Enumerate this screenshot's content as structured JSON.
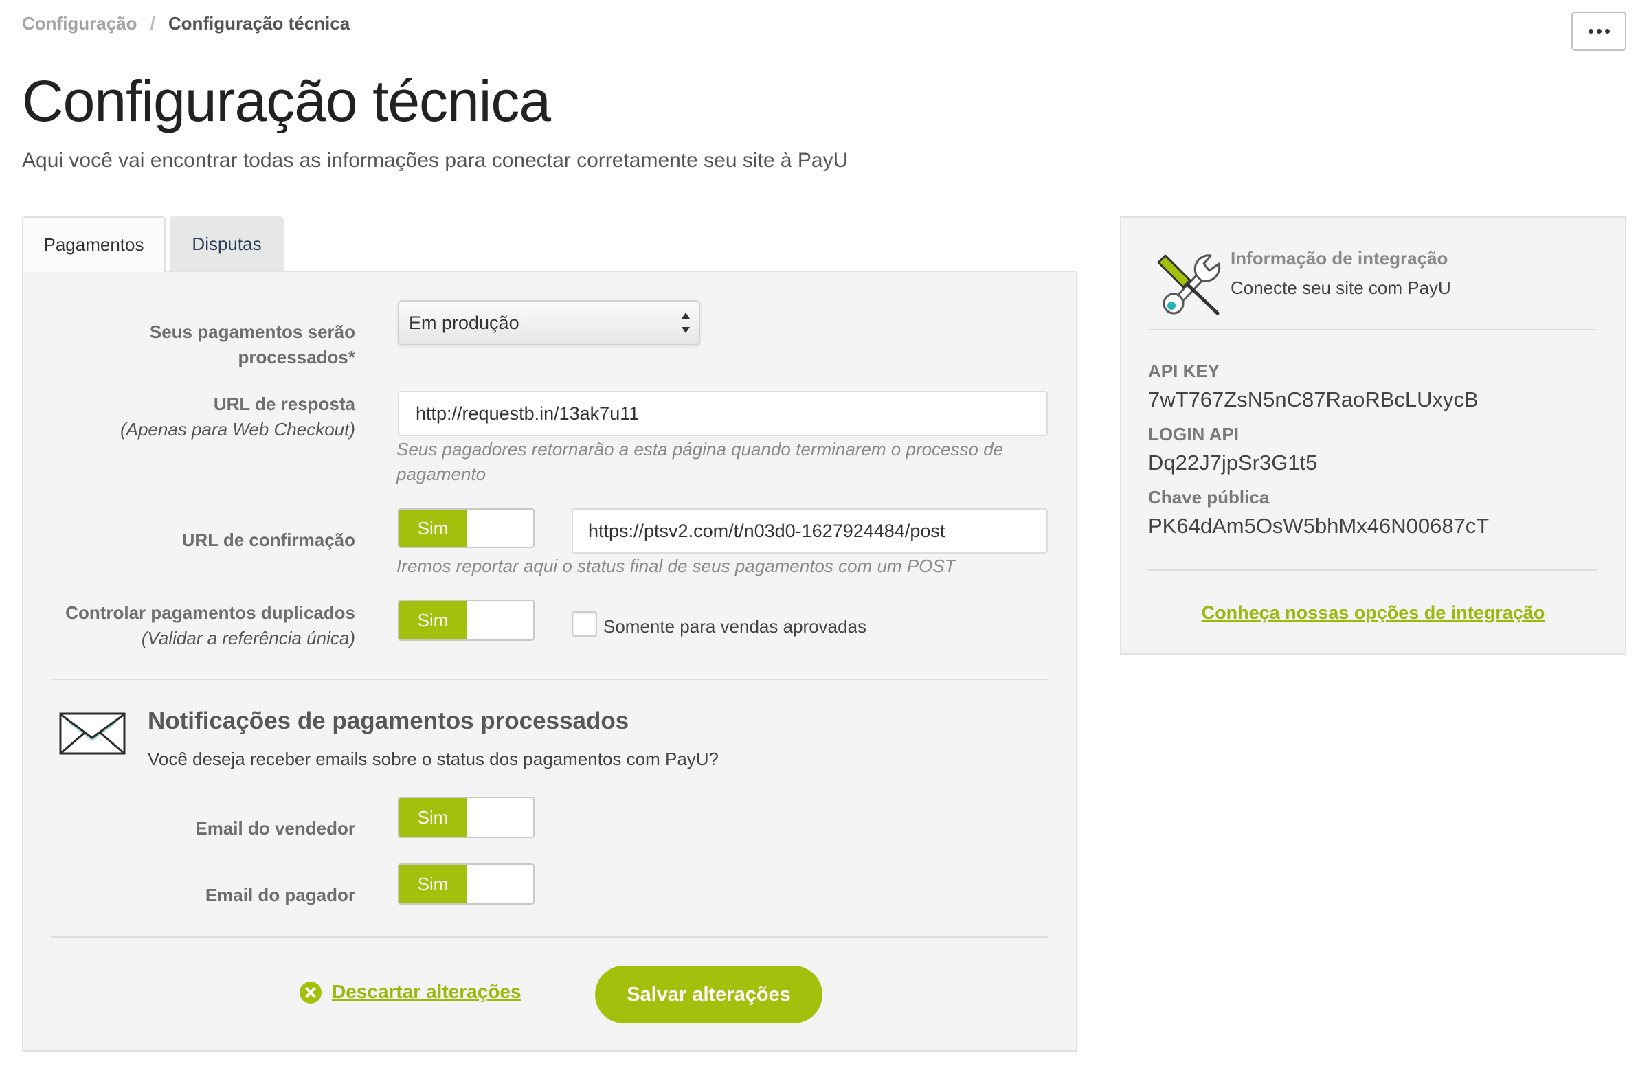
{
  "breadcrumb": {
    "parent": "Configuração",
    "separator": "/",
    "current": "Configuração técnica"
  },
  "header": {
    "title": "Configuração técnica",
    "subtitle": "Aqui você vai encontrar todas as informações para conectar corretamente seu site à PayU"
  },
  "tabs": [
    {
      "label": "Pagamentos",
      "active": true
    },
    {
      "label": "Disputas",
      "active": false
    }
  ],
  "form": {
    "processing": {
      "label": "Seus pagamentos serão processados*",
      "selected": "Em produção"
    },
    "response_url": {
      "label": "URL de resposta",
      "note": "(Apenas para Web Checkout)",
      "value": "http://requestb.in/13ak7u11",
      "help": "Seus pagadores retornarão a esta página quando terminarem o processo de pagamento"
    },
    "confirmation_url": {
      "label": "URL de confirmação",
      "toggle": {
        "label": "Sim",
        "on": true
      },
      "value": "https://ptsv2.com/t/n03d0-1627924484/post",
      "help": "Iremos reportar aqui o status final de seus pagamentos com um POST"
    },
    "duplicate_control": {
      "label": "Controlar pagamentos duplicados",
      "note": "(Validar a referência única)",
      "toggle": {
        "label": "Sim",
        "on": true
      },
      "approved_only": {
        "label": "Somente para vendas aprovadas",
        "checked": false
      }
    }
  },
  "notifications": {
    "title": "Notificações de pagamentos processados",
    "description": "Você deseja receber emails sobre o status dos pagamentos com PayU?",
    "seller_email": {
      "label": "Email do vendedor",
      "toggle": {
        "label": "Sim",
        "on": true
      }
    },
    "payer_email": {
      "label": "Email do pagador",
      "toggle": {
        "label": "Sim",
        "on": true
      }
    }
  },
  "actions": {
    "discard": "Descartar alterações",
    "save": "Salvar alterações"
  },
  "integration": {
    "title": "Informação de integração",
    "subtitle": "Conecte seu site com PayU",
    "fields": [
      {
        "label": "API KEY",
        "value": "7wT767ZsN5nC87RaoRBcLUxycB"
      },
      {
        "label": "LOGIN API",
        "value": "Dq22J7jpSr3G1t5"
      },
      {
        "label": "Chave pública",
        "value": "PK64dAm5OsW5bhMx46N00687cT"
      }
    ],
    "link": "Conheça nossas opções de integração"
  },
  "icons": {
    "more": "ellipsis-icon",
    "select": "select-arrows-icon",
    "notifications": "envelope-icon",
    "discard": "close-circle-icon",
    "integration": "tools-icon"
  },
  "colors": {
    "accent": "#a3c10c",
    "link": "#9cb80e",
    "text": "#333333",
    "panel": "#f4f4f4"
  }
}
